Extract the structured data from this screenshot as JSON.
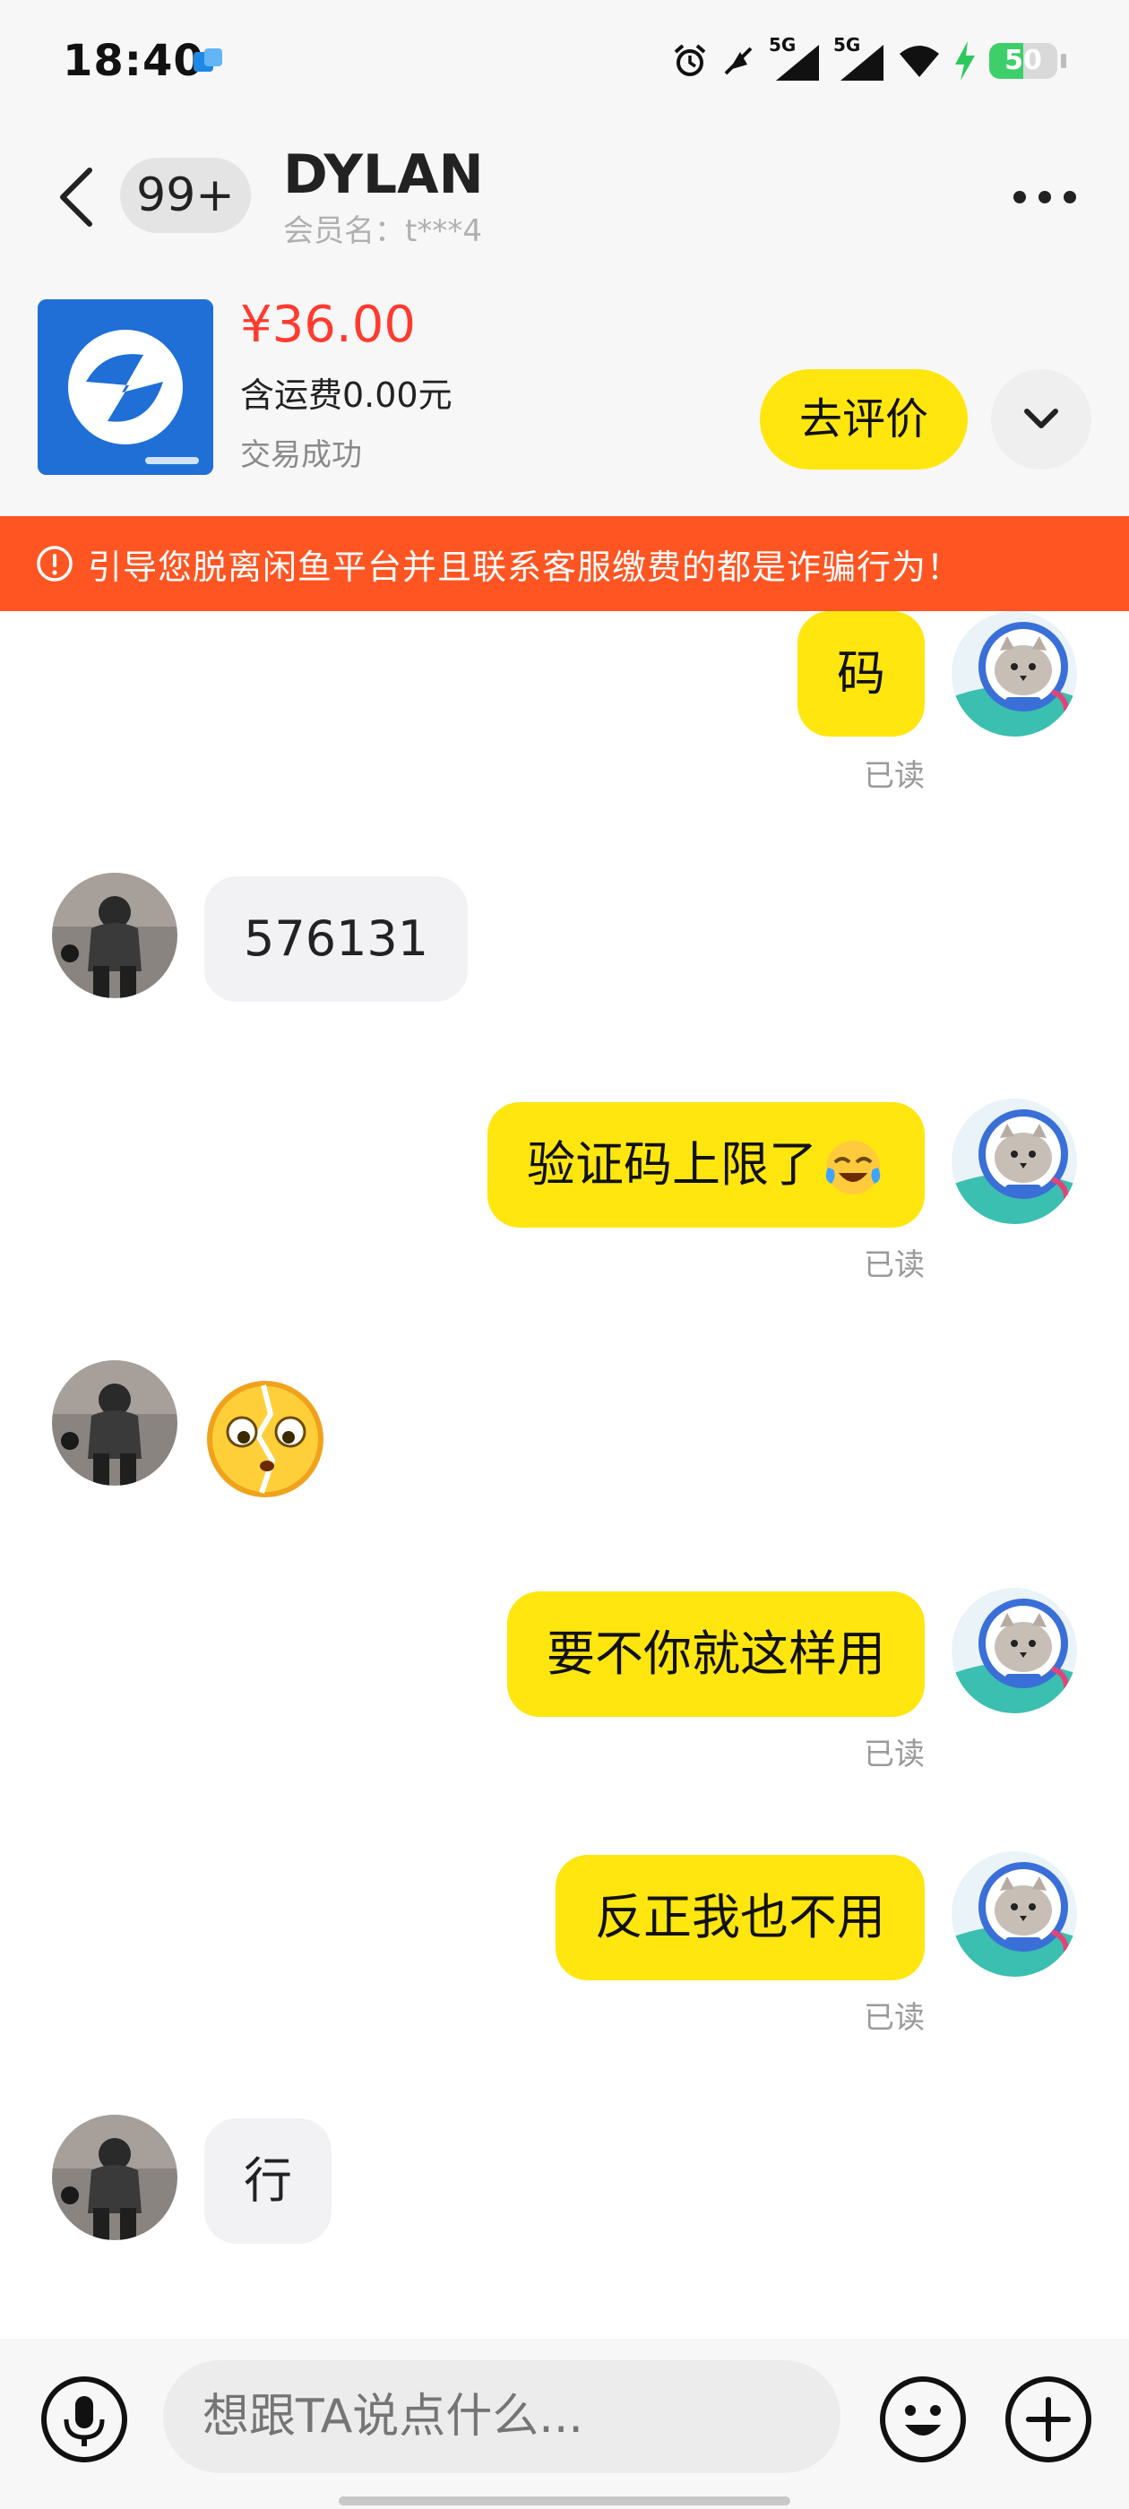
{
  "status_bar": {
    "time": "18:40",
    "network_1": "5G",
    "network_2": "5G",
    "battery_level": "50",
    "battery_percent": 0.5,
    "icons": [
      "app-notification-icon",
      "alarm-icon",
      "mute-icon",
      "signal-icon",
      "signal-icon",
      "wifi-icon",
      "charging-icon",
      "battery-icon"
    ]
  },
  "header": {
    "unread_count": "99+",
    "title": "DYLAN",
    "subtitle": "会员名：t***4",
    "icons": [
      "back-arrow-icon",
      "more-dots-icon"
    ]
  },
  "product": {
    "price": "¥36.00",
    "shipping": "含运费0.00元",
    "status": "交易成功",
    "review_label": "去评价",
    "icons": [
      "chevron-down-icon"
    ]
  },
  "warning": {
    "text": "引导您脱离闲鱼平台并且联系客服缴费的都是诈骗行为！",
    "icon": "exclamation-circle-icon"
  },
  "messages": [
    {
      "sender": "self",
      "text": "码",
      "read": "已读"
    },
    {
      "sender": "other",
      "text": "576131"
    },
    {
      "sender": "self",
      "text": "验证码上限了",
      "emoji": "crying-laughing-icon",
      "read": "已读"
    },
    {
      "sender": "other",
      "emoji": "broken-face-emoji-icon"
    },
    {
      "sender": "self",
      "text": "要不你就这样用",
      "read": "已读"
    },
    {
      "sender": "self",
      "text": "反正我也不用",
      "read": "已读"
    },
    {
      "sender": "other",
      "text": "行"
    }
  ],
  "input_bar": {
    "placeholder": "想跟TA说点什么...",
    "icons": [
      "microphone-icon",
      "smiley-icon",
      "plus-icon"
    ]
  },
  "colors": {
    "accent_yellow": "#ffe60f",
    "warning_orange": "#ff5522",
    "price_red": "#ff3b30"
  }
}
